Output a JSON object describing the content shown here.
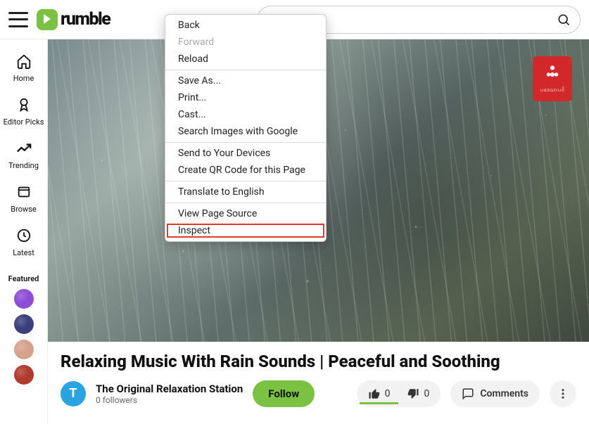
{
  "header": {
    "brand": "rumble",
    "search_placeholder": ""
  },
  "sidebar": {
    "nav": [
      {
        "icon": "home-icon",
        "label": "Home"
      },
      {
        "icon": "editor-picks-icon",
        "label": "Editor Picks"
      },
      {
        "icon": "trending-icon",
        "label": "Trending"
      },
      {
        "icon": "browse-icon",
        "label": "Browse"
      },
      {
        "icon": "latest-icon",
        "label": "Latest"
      }
    ],
    "featured_label": "Featured",
    "featured": [
      {
        "name": "featured-channel-1",
        "color": "#8e4dd6"
      },
      {
        "name": "featured-channel-2",
        "color": "#3a3f7d"
      },
      {
        "name": "featured-channel-3",
        "color": "#d6a28e"
      },
      {
        "name": "featured-channel-4",
        "color": "#b03a2e"
      }
    ]
  },
  "video": {
    "title": "Relaxing Music With Rain Sounds | Peaceful and Soothing",
    "watermark_text": "ပဒေသာပင်",
    "channel_initial": "T",
    "channel_name": "The Original Relaxation Station",
    "followers_text": "0 followers"
  },
  "actions": {
    "follow": "Follow",
    "likes": "0",
    "dislikes": "0",
    "comments_label": "Comments"
  },
  "context_menu": {
    "groups": [
      [
        {
          "label": "Back",
          "enabled": true,
          "highlight": false
        },
        {
          "label": "Forward",
          "enabled": false,
          "highlight": false
        },
        {
          "label": "Reload",
          "enabled": true,
          "highlight": false
        }
      ],
      [
        {
          "label": "Save As...",
          "enabled": true,
          "highlight": false
        },
        {
          "label": "Print...",
          "enabled": true,
          "highlight": false
        },
        {
          "label": "Cast...",
          "enabled": true,
          "highlight": false
        },
        {
          "label": "Search Images with Google",
          "enabled": true,
          "highlight": false
        }
      ],
      [
        {
          "label": "Send to Your Devices",
          "enabled": true,
          "highlight": false
        },
        {
          "label": "Create QR Code for this Page",
          "enabled": true,
          "highlight": false
        }
      ],
      [
        {
          "label": "Translate to English",
          "enabled": true,
          "highlight": false
        }
      ],
      [
        {
          "label": "View Page Source",
          "enabled": true,
          "highlight": false
        },
        {
          "label": "Inspect",
          "enabled": true,
          "highlight": true
        }
      ]
    ]
  }
}
